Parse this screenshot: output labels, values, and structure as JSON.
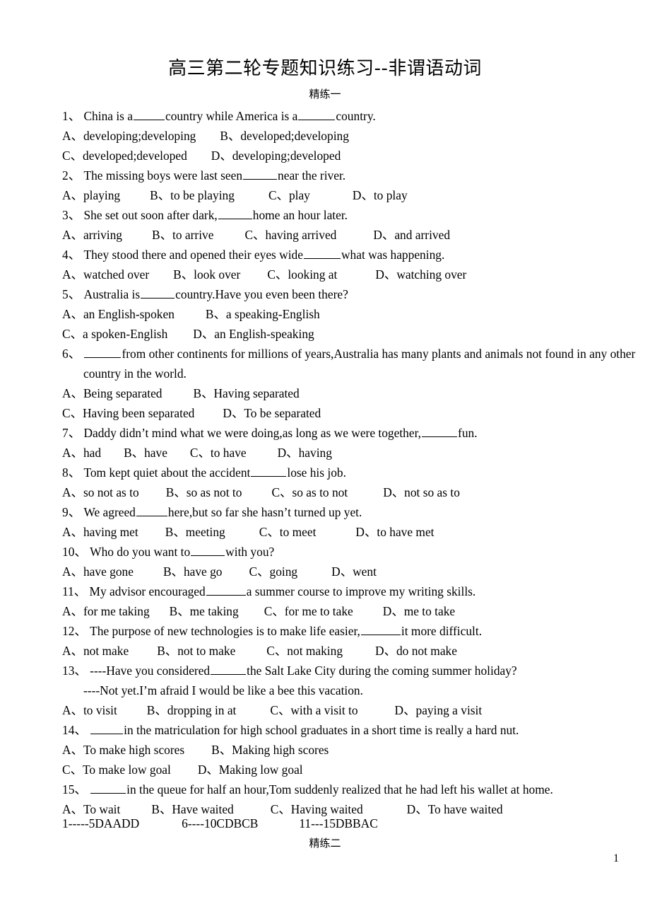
{
  "document": {
    "title": "高三第二轮专题知识练习--非谓语动词",
    "subtitle_top": "精练一",
    "subtitle_bottom": "精练二",
    "page_number": "1"
  },
  "questions": [
    {
      "number": "1、",
      "stem_parts": [
        "China is a",
        "country while America is a",
        "country."
      ],
      "blank_widths": [
        44,
        52
      ],
      "continuation": null,
      "options_rows": [
        [
          {
            "label": "A、",
            "text": "developing;developing",
            "gap": 0
          },
          {
            "label": "B、",
            "text": "developed;developing",
            "gap": 34
          }
        ],
        [
          {
            "label": "C、",
            "text": "developed;developed",
            "gap": 0
          },
          {
            "label": "D、",
            "text": "developing;developed",
            "gap": 34
          }
        ]
      ]
    },
    {
      "number": "2、",
      "stem_parts": [
        "The missing boys were last seen",
        "near the river."
      ],
      "blank_widths": [
        48
      ],
      "continuation": null,
      "options_rows": [
        [
          {
            "label": "A、",
            "text": "playing",
            "gap": 0
          },
          {
            "label": "B、",
            "text": "to be playing",
            "gap": 42
          },
          {
            "label": "C、",
            "text": "play",
            "gap": 48
          },
          {
            "label": "D、",
            "text": "to play",
            "gap": 60
          }
        ]
      ]
    },
    {
      "number": "3、",
      "stem_parts": [
        "She set out soon after dark,",
        "home an hour later."
      ],
      "blank_widths": [
        48
      ],
      "continuation": null,
      "options_rows": [
        [
          {
            "label": "A、",
            "text": "arriving",
            "gap": 0
          },
          {
            "label": "B、",
            "text": "to arrive",
            "gap": 42
          },
          {
            "label": "C、",
            "text": "having arrived",
            "gap": 44
          },
          {
            "label": "D、",
            "text": "and arrived",
            "gap": 52
          }
        ]
      ]
    },
    {
      "number": "4、",
      "stem_parts": [
        "They stood there and opened their eyes wide",
        "what was happening."
      ],
      "blank_widths": [
        52
      ],
      "continuation": null,
      "options_rows": [
        [
          {
            "label": "A、",
            "text": "watched over",
            "gap": 0
          },
          {
            "label": "B、",
            "text": "look over",
            "gap": 34
          },
          {
            "label": "C、",
            "text": "looking at",
            "gap": 38
          },
          {
            "label": "D、",
            "text": "watching over",
            "gap": 54
          }
        ]
      ]
    },
    {
      "number": "5、",
      "stem_parts": [
        "Australia is",
        "country.Have you even been there?"
      ],
      "blank_widths": [
        48
      ],
      "continuation": null,
      "options_rows": [
        [
          {
            "label": "A、",
            "text": "an English-spoken",
            "gap": 0
          },
          {
            "label": "B、",
            "text": "a speaking-English",
            "gap": 44
          }
        ],
        [
          {
            "label": "C、",
            "text": "a spoken-English",
            "gap": 0
          },
          {
            "label": "D、",
            "text": "an English-speaking",
            "gap": 36
          }
        ]
      ]
    },
    {
      "number": "6、",
      "stem_parts": [
        "",
        "from other continents for millions of years,Australia has many plants and animals not found in any other"
      ],
      "blank_widths": [
        52
      ],
      "continuation": "country in the world.",
      "options_rows": [
        [
          {
            "label": "A、",
            "text": "Being separated",
            "gap": 0
          },
          {
            "label": "B、",
            "text": "Having separated",
            "gap": 44
          }
        ],
        [
          {
            "label": "C、",
            "text": "Having been separated",
            "gap": 0
          },
          {
            "label": "D、",
            "text": "To be separated",
            "gap": 40
          }
        ]
      ]
    },
    {
      "number": "7、",
      "stem_parts": [
        "Daddy didn’t mind what we were doing,as long as we were together,",
        "fun."
      ],
      "blank_widths": [
        50
      ],
      "continuation": null,
      "options_rows": [
        [
          {
            "label": "A、",
            "text": "had",
            "gap": 0
          },
          {
            "label": "B、",
            "text": "have",
            "gap": 32
          },
          {
            "label": "C、",
            "text": "to have",
            "gap": 32
          },
          {
            "label": "D、",
            "text": "having",
            "gap": 44
          }
        ]
      ]
    },
    {
      "number": "8、",
      "stem_parts": [
        "Tom kept quiet about the accident",
        "lose his job."
      ],
      "blank_widths": [
        50
      ],
      "continuation": null,
      "options_rows": [
        [
          {
            "label": "A、",
            "text": "so not as to",
            "gap": 0
          },
          {
            "label": "B、",
            "text": "so as not to",
            "gap": 38
          },
          {
            "label": "C、",
            "text": "so as to not",
            "gap": 42
          },
          {
            "label": "D、",
            "text": "not so as to",
            "gap": 50
          }
        ]
      ]
    },
    {
      "number": "9、",
      "stem_parts": [
        "We agreed",
        "here,but so far she hasn’t turned up yet."
      ],
      "blank_widths": [
        44
      ],
      "continuation": null,
      "options_rows": [
        [
          {
            "label": "A、",
            "text": "having met",
            "gap": 0
          },
          {
            "label": "B、",
            "text": "meeting",
            "gap": 38
          },
          {
            "label": "C、",
            "text": "to meet",
            "gap": 48
          },
          {
            "label": "D、",
            "text": "to have met",
            "gap": 56
          }
        ]
      ]
    },
    {
      "number": "10、",
      "stem_parts": [
        "Who do you want to",
        "with you?"
      ],
      "blank_widths": [
        48
      ],
      "continuation": null,
      "options_rows": [
        [
          {
            "label": "A、",
            "text": "have gone",
            "gap": 0
          },
          {
            "label": "B、",
            "text": "have go",
            "gap": 42
          },
          {
            "label": "C、",
            "text": "going",
            "gap": 38
          },
          {
            "label": "D、",
            "text": "went",
            "gap": 48
          }
        ]
      ]
    },
    {
      "number": "11、",
      "stem_parts": [
        "My advisor encouraged",
        "a summer course to improve my writing skills."
      ],
      "blank_widths": [
        56
      ],
      "continuation": null,
      "options_rows": [
        [
          {
            "label": "A、",
            "text": "for me taking",
            "gap": 0
          },
          {
            "label": "B、",
            "text": "me taking",
            "gap": 28
          },
          {
            "label": "C、",
            "text": "for me to take",
            "gap": 36
          },
          {
            "label": "D、",
            "text": "me to take",
            "gap": 42
          }
        ]
      ]
    },
    {
      "number": "12、",
      "stem_parts": [
        "The purpose of new technologies is to make life easier,",
        "it more difficult."
      ],
      "blank_widths": [
        56
      ],
      "continuation": null,
      "options_rows": [
        [
          {
            "label": "A、",
            "text": "not make",
            "gap": 0
          },
          {
            "label": "B、",
            "text": "not to make",
            "gap": 40
          },
          {
            "label": "C、",
            "text": "not making",
            "gap": 44
          },
          {
            "label": "D、",
            "text": "do not make",
            "gap": 46
          }
        ]
      ]
    },
    {
      "number": "13、",
      "stem_parts": [
        "----Have you considered",
        "the Salt Lake City during the coming summer holiday?"
      ],
      "blank_widths": [
        50
      ],
      "continuation": "----Not yet.I’m afraid I would be like a bee this vacation.",
      "options_rows": [
        [
          {
            "label": "A、",
            "text": "to visit",
            "gap": 0
          },
          {
            "label": "B、",
            "text": "dropping in at",
            "gap": 42
          },
          {
            "label": "C、",
            "text": "with a visit to",
            "gap": 48
          },
          {
            "label": "D、",
            "text": "paying a visit",
            "gap": 52
          }
        ]
      ]
    },
    {
      "number": "14、",
      "stem_parts": [
        "",
        "in the matriculation for high school graduates in a short time is really a hard nut."
      ],
      "blank_widths": [
        46
      ],
      "continuation": null,
      "options_rows": [
        [
          {
            "label": "A、",
            "text": "To make high scores",
            "gap": 0
          },
          {
            "label": "B、",
            "text": "Making high scores",
            "gap": 38
          }
        ],
        [
          {
            "label": "C、",
            "text": "To make low goal",
            "gap": 0
          },
          {
            "label": "D、",
            "text": "Making low goal",
            "gap": 38
          }
        ]
      ]
    },
    {
      "number": "15、",
      "stem_parts": [
        "",
        "in the queue for half an hour,Tom suddenly realized that he had left his wallet at home."
      ],
      "blank_widths": [
        50
      ],
      "continuation": null,
      "options_rows": [
        [
          {
            "label": "A、",
            "text": "To wait",
            "gap": 0
          },
          {
            "label": "B、",
            "text": "Have waited",
            "gap": 44
          },
          {
            "label": "C、",
            "text": "Having waited",
            "gap": 52
          },
          {
            "label": "D、",
            "text": "To have waited",
            "gap": 62
          }
        ]
      ]
    }
  ],
  "answer_key": [
    {
      "text": "1-----5DAADD",
      "gap": 0
    },
    {
      "text": "6----10CDBCB",
      "gap": 60
    },
    {
      "text": "11---15DBBAC",
      "gap": 58
    }
  ]
}
